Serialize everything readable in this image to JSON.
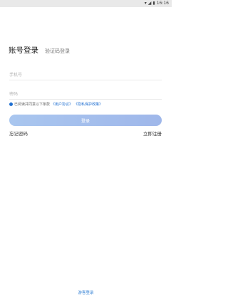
{
  "status_bar": {
    "time": "16:16"
  },
  "tabs": {
    "password_login": "账号登录",
    "sms_login": "验证码登录"
  },
  "form": {
    "phone_placeholder": "手机号",
    "password_placeholder": "密码"
  },
  "agreement": {
    "text": "已阅读并同意以下条款",
    "user_agreement": "《用户协议》",
    "privacy_policy": "《隐私保护政策》"
  },
  "login_button": "登录",
  "forgot_password": "忘记密码",
  "register": "立即注册",
  "bottom_link": "游客登录",
  "colors": {
    "accent": "#1f6fd1",
    "button_start": "#a9c6ef",
    "button_end": "#9fb7ea"
  }
}
